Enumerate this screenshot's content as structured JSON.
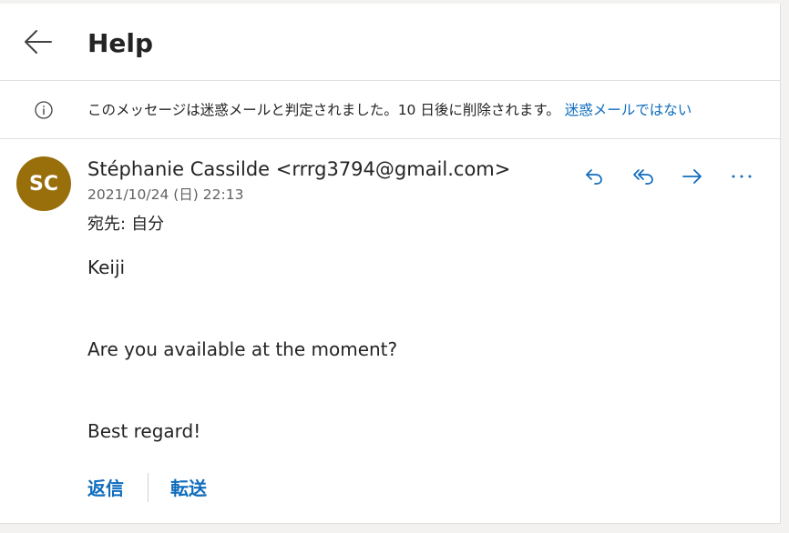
{
  "header": {
    "title": "Help",
    "back_icon": "arrow-left-icon"
  },
  "banner": {
    "icon": "info-icon",
    "message": "このメッセージは迷惑メールと判定されました。10 日後に削除されます。",
    "not_junk_link": "迷惑メールではない"
  },
  "message": {
    "avatar_initials": "SC",
    "avatar_color": "#986f0b",
    "sender": "Stéphanie Cassilde <rrrg3794@gmail.com>",
    "date": "2021/10/24 (日) 22:13",
    "to_label": "宛先:",
    "to_value": "自分",
    "actions": [
      {
        "name": "reply",
        "icon": "reply-icon"
      },
      {
        "name": "reply-all",
        "icon": "reply-all-icon"
      },
      {
        "name": "forward",
        "icon": "forward-icon"
      },
      {
        "name": "more",
        "icon": "more-icon"
      }
    ],
    "body": {
      "greeting": "Keiji",
      "line1": "Are you available at the moment?",
      "closing": "Best regard!"
    }
  },
  "footer": {
    "reply_label": "返信",
    "forward_label": "転送"
  },
  "colors": {
    "accent": "#0f6cbd",
    "text": "#242424",
    "secondary_text": "#616161"
  }
}
